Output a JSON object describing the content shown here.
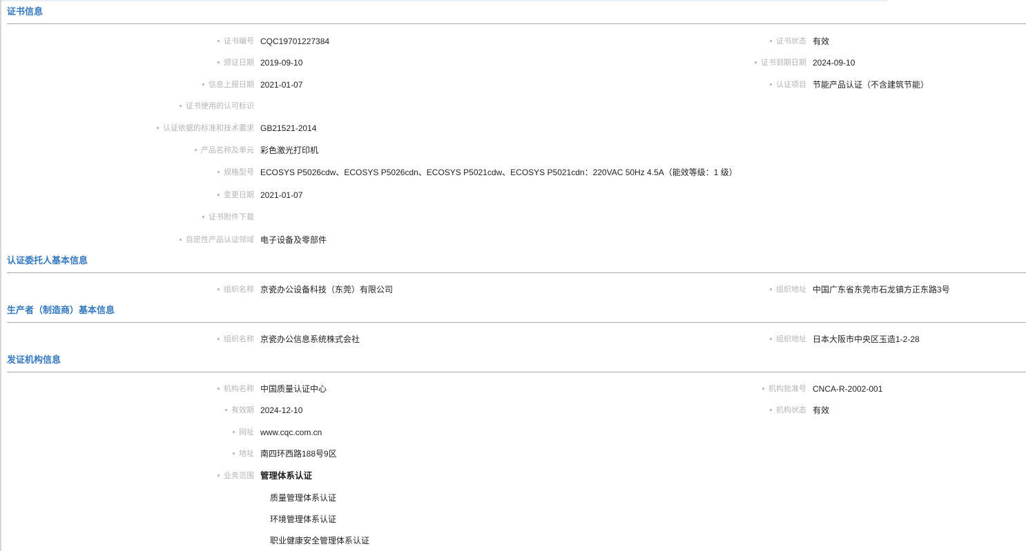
{
  "sections": {
    "cert_info": {
      "title": "证书信息",
      "rows_left": [
        {
          "key": "cert_no",
          "label": "证书编号",
          "value": "CQC19701227384"
        },
        {
          "key": "issue_date",
          "label": "颁证日期",
          "value": "2019-09-10"
        },
        {
          "key": "report_date",
          "label": "信息上报日期",
          "value": "2021-01-07"
        },
        {
          "key": "usage_mark",
          "label": "证书使用的认可标识",
          "value": ""
        },
        {
          "key": "standard",
          "label": "认证依据的标准和技术要求",
          "value": "GB21521-2014"
        },
        {
          "key": "product",
          "label": "产品名称及单元",
          "value": "彩色激光打印机"
        },
        {
          "key": "model",
          "label": "规格型号",
          "value": "ECOSYS P5026cdw、ECOSYS P5026cdn、ECOSYS P5021cdw、ECOSYS P5021cdn：220VAC 50Hz 4.5A（能效等级：1 级）"
        },
        {
          "key": "change_date",
          "label": "变更日期",
          "value": "2021-01-07"
        },
        {
          "key": "attachment",
          "label": "证书附件下载",
          "value": ""
        },
        {
          "key": "voluntary_field",
          "label": "自愿性产品认证领域",
          "value": "电子设备及零部件"
        }
      ],
      "rows_right": [
        {
          "key": "status",
          "label": "证书状态",
          "value": "有效"
        },
        {
          "key": "expiry",
          "label": "证书到期日期",
          "value": "2024-09-10"
        },
        {
          "key": "project",
          "label": "认证项目",
          "value": "节能产品认证（不含建筑节能）"
        }
      ]
    },
    "client_info": {
      "title": "认证委托人基本信息",
      "org_name_label": "组织名称",
      "org_name": "京瓷办公设备科技（东莞）有限公司",
      "org_addr_label": "组织地址",
      "org_addr": "中国广东省东莞市石龙镇方正东路3号"
    },
    "manufacturer_info": {
      "title": "生产者（制造商）基本信息",
      "org_name_label": "组织名称",
      "org_name": "京瓷办公信息系统株式会社",
      "org_addr_label": "组织地址",
      "org_addr": "日本大阪市中央区玉造1-2-28"
    },
    "issuer_info": {
      "title": "发证机构信息",
      "name_label": "机构名称",
      "name": "中国质量认证中心",
      "approval_label": "机构批准号",
      "approval": "CNCA-R-2002-001",
      "valid_label": "有效期",
      "valid": "2024-12-10",
      "status_label": "机构状态",
      "status": "有效",
      "website_label": "网址",
      "website": "www.cqc.com.cn",
      "address_label": "地址",
      "address": "南四环西路188号9区",
      "scope_label": "业务范围",
      "scope_main": "管理体系认证",
      "scope_items": [
        "质量管理体系认证",
        "环境管理体系认证",
        "职业健康安全管理体系认证"
      ]
    }
  }
}
